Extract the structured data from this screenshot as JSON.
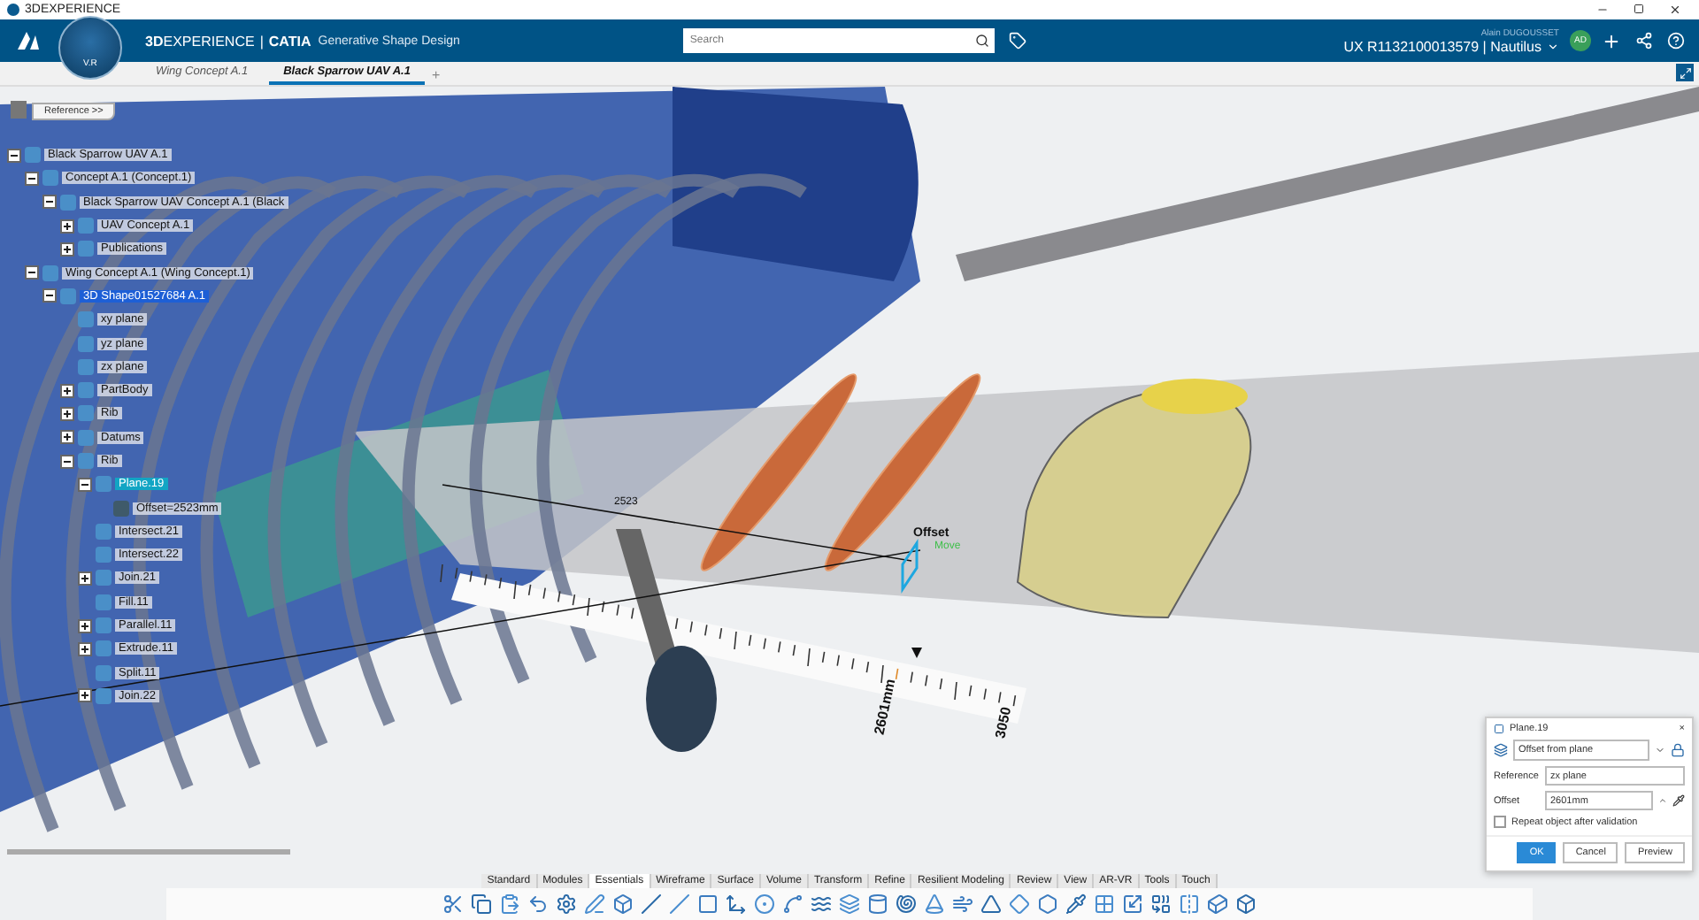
{
  "window": {
    "title": "3DEXPERIENCE"
  },
  "header": {
    "brand": "**3D**EXPERIENCE",
    "separator": "|",
    "app": "CATIA",
    "module": "Generative Shape Design",
    "compass_label": "V.R",
    "search": {
      "placeholder": "Search"
    },
    "user": "Alain DUGOUSSET",
    "context": "UX R1132100013579 | Nautilus",
    "avatar": "AD"
  },
  "tabs": [
    {
      "label": "Wing Concept A.1",
      "selected": false
    },
    {
      "label": "Black Sparrow UAV A.1",
      "selected": true
    }
  ],
  "new_tab": "+",
  "reference_button": "Reference >>",
  "tree": [
    {
      "label": "Black Sparrow UAV A.1",
      "selected": false,
      "current": false,
      "expanded": true,
      "children": [
        {
          "label": "Concept A.1 (Concept.1)",
          "selected": false,
          "current": false,
          "expanded": true,
          "children": [
            {
              "label": "Black Sparrow UAV Concept A.1 (Black",
              "selected": false,
              "current": false,
              "expanded": true,
              "children": [
                {
                  "label": "UAV Concept A.1",
                  "selected": false,
                  "current": false,
                  "expanded": false
                },
                {
                  "label": "Publications",
                  "selected": false,
                  "current": false,
                  "expanded": false
                }
              ]
            }
          ]
        },
        {
          "label": "Wing Concept A.1 (Wing Concept.1)",
          "selected": false,
          "current": false,
          "expanded": true,
          "children": [
            {
              "label": "3D Shape01527684 A.1",
              "selected": false,
              "current": true,
              "expanded": true,
              "children": [
                {
                  "label": "xy plane",
                  "selected": false,
                  "current": false
                },
                {
                  "label": "yz plane",
                  "selected": false,
                  "current": false
                },
                {
                  "label": "zx plane",
                  "selected": false,
                  "current": false
                },
                {
                  "label": "PartBody",
                  "selected": false,
                  "current": false,
                  "expanded": false
                },
                {
                  "label": "Rib",
                  "selected": false,
                  "current": false,
                  "expanded": false
                },
                {
                  "label": "Datums",
                  "selected": false,
                  "current": false,
                  "expanded": false
                },
                {
                  "label": "Rib",
                  "selected": false,
                  "current": false,
                  "expanded": true,
                  "children": [
                    {
                      "label": "Plane.19",
                      "selected": true,
                      "current": false,
                      "expanded": true,
                      "children": [
                        {
                          "label": "Offset=2523mm",
                          "selected": false,
                          "current": false
                        }
                      ]
                    },
                    {
                      "label": "Intersect.21",
                      "selected": false,
                      "current": false
                    },
                    {
                      "label": "Intersect.22",
                      "selected": false,
                      "current": false
                    },
                    {
                      "label": "Join.21",
                      "selected": false,
                      "current": false,
                      "expanded": false
                    },
                    {
                      "label": "Fill.11",
                      "selected": false,
                      "current": false
                    },
                    {
                      "label": "Parallel.11",
                      "selected": false,
                      "current": false,
                      "expanded": false
                    },
                    {
                      "label": "Extrude.11",
                      "selected": false,
                      "current": false,
                      "expanded": false
                    },
                    {
                      "label": "Split.11",
                      "selected": false,
                      "current": false
                    },
                    {
                      "label": "Join.22",
                      "selected": false,
                      "current": false,
                      "expanded": false
                    }
                  ]
                }
              ]
            }
          ]
        }
      ]
    }
  ],
  "viewport_labels": {
    "dimension": "2523",
    "offset": "Offset",
    "move": "Move",
    "ruler_value": "2601mm",
    "ruler_tick": "3050"
  },
  "dialog": {
    "title": "Plane.19",
    "close": "×",
    "type": "Offset from plane",
    "reference_label": "Reference",
    "reference_value": "zx plane",
    "offset_label": "Offset",
    "offset_value": "2601mm",
    "repeat_label": "Repeat object after validation",
    "repeat_checked": false,
    "buttons": [
      {
        "label": "OK",
        "primary": true
      },
      {
        "label": "Cancel",
        "primary": false
      },
      {
        "label": "Preview",
        "primary": false
      }
    ]
  },
  "action_bar": {
    "tabs": [
      {
        "label": "Standard",
        "selected": false
      },
      {
        "label": "Modules",
        "selected": false
      },
      {
        "label": "Essentials",
        "selected": true
      },
      {
        "label": "Wireframe",
        "selected": false
      },
      {
        "label": "Surface",
        "selected": false
      },
      {
        "label": "Volume",
        "selected": false
      },
      {
        "label": "Transform",
        "selected": false
      },
      {
        "label": "Refine",
        "selected": false
      },
      {
        "label": "Resilient Modeling",
        "selected": false
      },
      {
        "label": "Review",
        "selected": false
      },
      {
        "label": "View",
        "selected": false
      },
      {
        "label": "AR-VR",
        "selected": false
      },
      {
        "label": "Tools",
        "selected": false
      },
      {
        "label": "Touch",
        "selected": false
      }
    ]
  }
}
